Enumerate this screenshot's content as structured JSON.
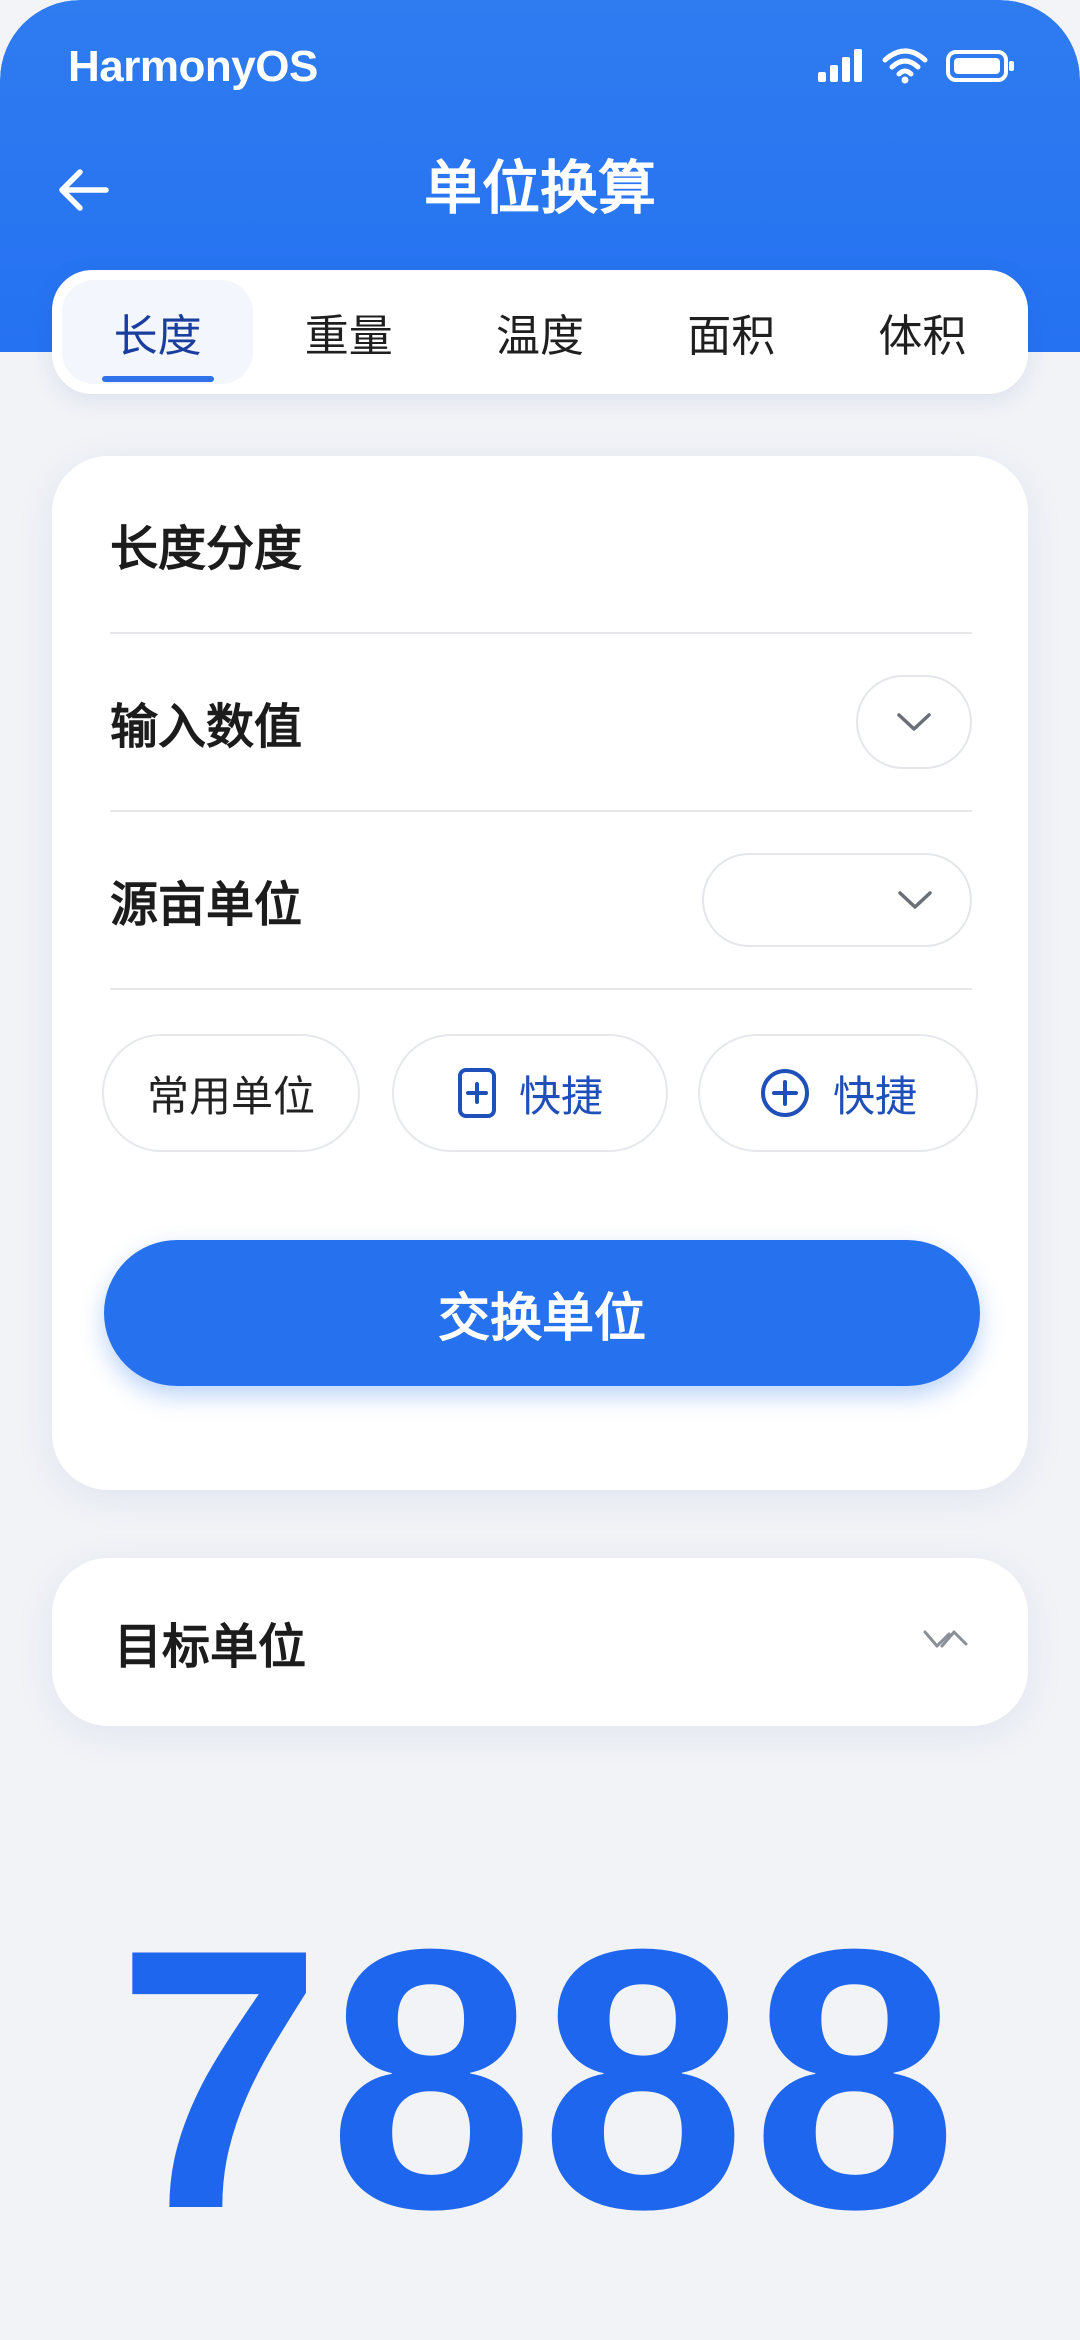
{
  "status_bar": {
    "os_name": "HarmonyOS",
    "icons": [
      "signal-icon",
      "wifi-icon",
      "battery-icon"
    ]
  },
  "header": {
    "title": "单位换算",
    "back_icon": "back-arrow-icon"
  },
  "tabs": [
    {
      "label": "长度",
      "active": true
    },
    {
      "label": "重量",
      "active": false
    },
    {
      "label": "温度",
      "active": false
    },
    {
      "label": "面积",
      "active": false
    },
    {
      "label": "体积",
      "active": false
    }
  ],
  "form": {
    "category_label": "长度分度",
    "value_label": "输入数值",
    "source_unit_label": "源亩单位",
    "chips": [
      {
        "label": "常用单位",
        "icon": ""
      },
      {
        "label": "快捷",
        "icon": "square-plus-icon"
      },
      {
        "label": "快捷",
        "icon": "circle-plus-icon"
      }
    ],
    "swap_button": "交换单位"
  },
  "target": {
    "label": "目标单位",
    "icon": "double-chevron-icon"
  },
  "result": {
    "value": "7888"
  },
  "colors": {
    "primary": "#2571ee",
    "header_bg": "#2f7bf0",
    "result_text": "#1f66ee",
    "active_tab_text": "#1a3e9e"
  }
}
